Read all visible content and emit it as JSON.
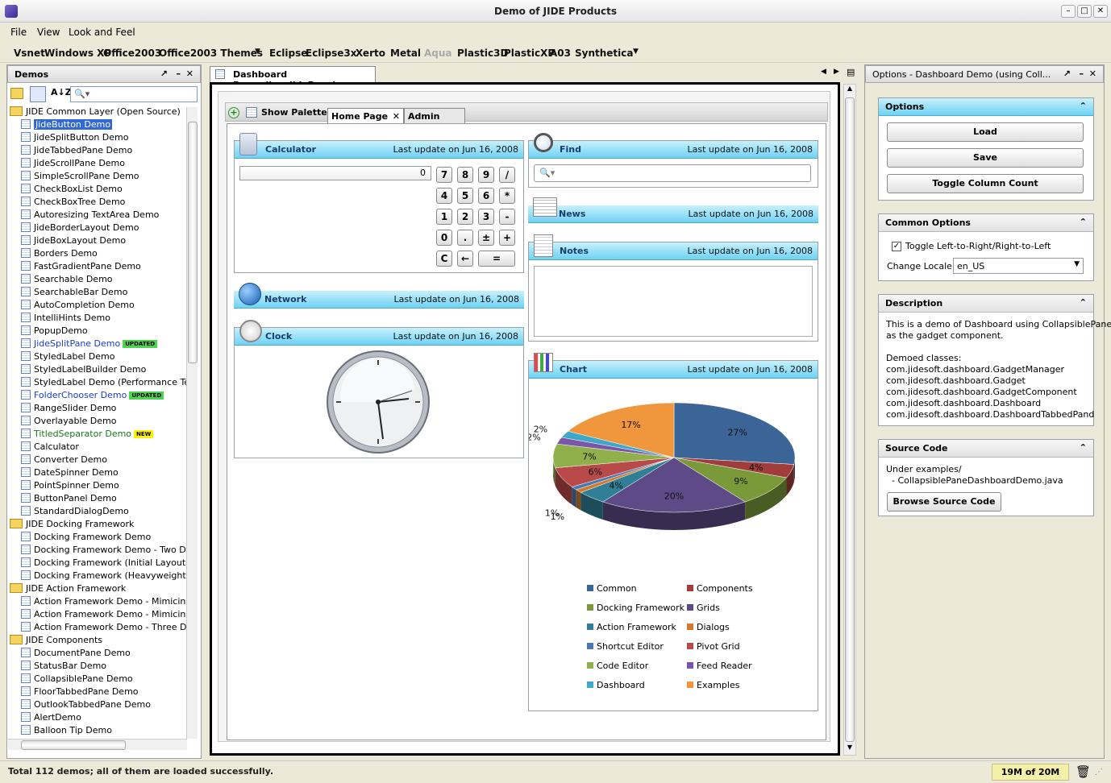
{
  "window": {
    "title": "Demo of JIDE Products",
    "min": "–",
    "max": "□",
    "close": "✕"
  },
  "menu": [
    "File",
    "View",
    "Look and Feel"
  ],
  "laf": [
    "Vsnet",
    "Windows XP",
    "Office2003",
    "Office2003 Themes",
    "Eclipse",
    "Eclipse3x",
    "Xerto",
    "Metal",
    "Aqua",
    "Plastic3D",
    "PlasticXP",
    "A03",
    "Synthetica"
  ],
  "left": {
    "title": "Demos",
    "items": [
      {
        "label": "JIDE Common Layer (Open Source)",
        "folder": true
      },
      {
        "label": "JideButton Demo",
        "selected": true
      },
      {
        "label": "JideSplitButton Demo"
      },
      {
        "label": "JideTabbedPane Demo"
      },
      {
        "label": "JideScrollPane Demo"
      },
      {
        "label": "SimpleScrollPane Demo"
      },
      {
        "label": "CheckBoxList Demo"
      },
      {
        "label": "CheckBoxTree Demo"
      },
      {
        "label": "Autoresizing TextArea Demo"
      },
      {
        "label": "JideBorderLayout Demo"
      },
      {
        "label": "JideBoxLayout Demo"
      },
      {
        "label": "Borders Demo"
      },
      {
        "label": "FastGradientPane Demo"
      },
      {
        "label": "Searchable Demo"
      },
      {
        "label": "SearchableBar Demo"
      },
      {
        "label": "AutoCompletion Demo"
      },
      {
        "label": "IntelliHints Demo"
      },
      {
        "label": "PopupDemo"
      },
      {
        "label": "JideSplitPane Demo",
        "badge": "UPDATED",
        "color": "#1a3dcc"
      },
      {
        "label": "StyledLabel Demo"
      },
      {
        "label": "StyledLabelBuilder Demo"
      },
      {
        "label": "StyledLabel Demo (Performance Test)"
      },
      {
        "label": "FolderChooser Demo",
        "badge": "UPDATED",
        "color": "#1a3dcc"
      },
      {
        "label": "RangeSlider Demo"
      },
      {
        "label": "Overlayable Demo"
      },
      {
        "label": "TitledSeparator Demo",
        "badge": "NEW",
        "color": "#1a7a1a"
      },
      {
        "label": "Calculator"
      },
      {
        "label": "Converter Demo"
      },
      {
        "label": "DateSpinner Demo"
      },
      {
        "label": "PointSpinner Demo"
      },
      {
        "label": "ButtonPanel Demo"
      },
      {
        "label": "StandardDialogDemo"
      },
      {
        "label": "JIDE Docking Framework",
        "folder": true
      },
      {
        "label": "Docking Framework Demo"
      },
      {
        "label": "Docking Framework Demo - Two Docki"
      },
      {
        "label": "Docking Framework (Initial Layout) De"
      },
      {
        "label": "Docking Framework (Heavyweight Cor"
      },
      {
        "label": "JIDE Action Framework",
        "folder": true
      },
      {
        "label": "Action Framework Demo - Mimicing Visi"
      },
      {
        "label": "Action Framework Demo - Mimicing Mic"
      },
      {
        "label": "Action Framework Demo - Three Docka"
      },
      {
        "label": "JIDE Components",
        "folder": true
      },
      {
        "label": "DocumentPane Demo"
      },
      {
        "label": "StatusBar Demo"
      },
      {
        "label": "CollapsiblePane Demo"
      },
      {
        "label": "FloorTabbedPane Demo"
      },
      {
        "label": "OutlookTabbedPane Demo"
      },
      {
        "label": "AlertDemo"
      },
      {
        "label": "Balloon Tip Demo"
      }
    ]
  },
  "center": {
    "doc_tab": "Dashboard Dem...llapsiblePane)",
    "show_palette": "Show Palette",
    "tabs": [
      "Home Page",
      "Admin Page"
    ],
    "update": "Last update on Jun 16, 2008",
    "gadgets": {
      "calculator": "Calculator",
      "network": "Network",
      "clock": "Clock",
      "find": "Find",
      "news": "News",
      "notes": "Notes",
      "chart": "Chart"
    },
    "calc_display": "0",
    "calc_keys": [
      "7",
      "8",
      "9",
      "/",
      "4",
      "5",
      "6",
      "*",
      "1",
      "2",
      "3",
      "-",
      "0",
      ".",
      "±",
      "+",
      "C",
      "←",
      "="
    ]
  },
  "chart_data": {
    "type": "pie",
    "categories": [
      "Common",
      "Components",
      "Docking Framework",
      "Grids",
      "Action Framework",
      "Dialogs",
      "Shortcut Editor",
      "Pivot Grid",
      "Code Editor",
      "Feed Reader",
      "Dashboard",
      "Examples"
    ],
    "values": [
      27,
      4,
      9,
      20,
      4,
      1,
      1,
      6,
      7,
      2,
      2,
      17
    ],
    "labels": [
      "27%",
      "4%",
      "9%",
      "20%",
      "4%",
      "1%",
      "1%",
      "6%",
      "7%",
      "2%",
      "2%",
      "17%"
    ],
    "colors": [
      "#3b6596",
      "#a13c3c",
      "#7a9a3a",
      "#5e4a86",
      "#317f96",
      "#d17a2e",
      "#4a78b0",
      "#b84a4a",
      "#8fb04a",
      "#7a56a8",
      "#3fa7c8",
      "#f0963c"
    ],
    "legend": "bottom"
  },
  "right": {
    "title": "Options - Dashboard Demo (using Coll...",
    "options": "Options",
    "load": "Load",
    "save": "Save",
    "toggle": "Toggle Column Count",
    "common": "Common Options",
    "ltr": "Toggle Left-to-Right/Right-to-Left",
    "locale_label": "Change Locale:",
    "locale": "en_US",
    "description": "Description",
    "desc_lines": [
      "This is a demo of Dashboard using CollapsiblePane",
      "as the gadget component.",
      "",
      "Demoed classes:",
      "com.jidesoft.dashboard.GadgetManager",
      "com.jidesoft.dashboard.Gadget",
      "com.jidesoft.dashboard.GadgetComponent",
      "com.jidesoft.dashboard.Dashboard",
      "com.jidesoft.dashboard.DashboardTabbedPand"
    ],
    "source": "Source Code",
    "src_lines": [
      "Under examples/",
      "  - CollapsiblePaneDashboardDemo.java"
    ],
    "browse": "Browse Source Code"
  },
  "status": {
    "text": "Total 112 demos; all of them are loaded successfully.",
    "memory": "19M of 20M"
  }
}
